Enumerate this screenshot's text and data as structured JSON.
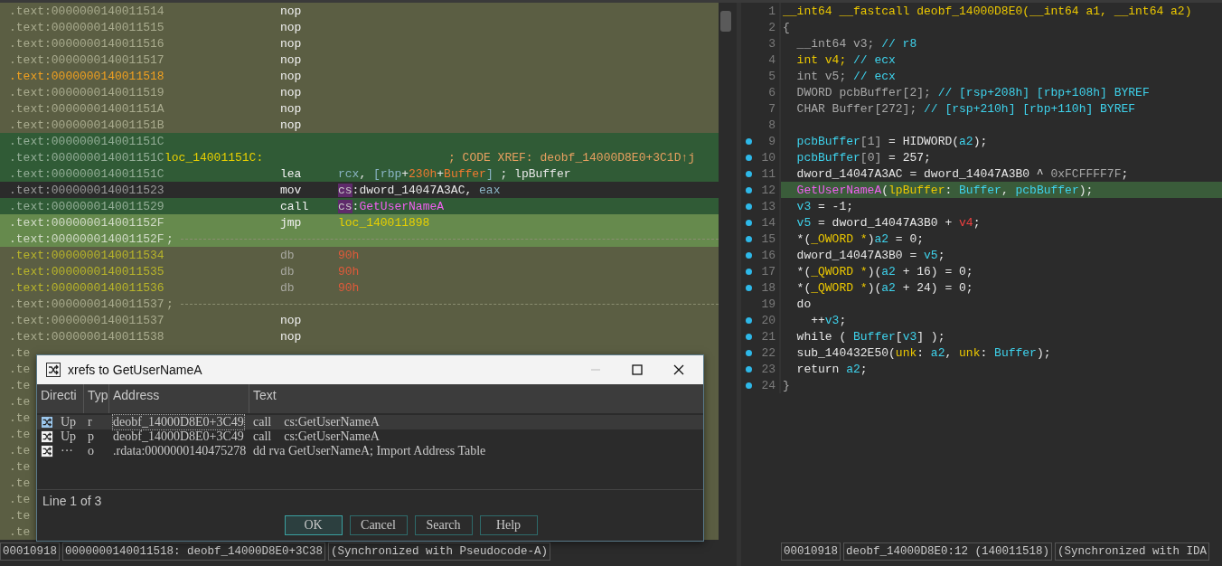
{
  "listing": {
    "rows": [
      {
        "address": ".text:0000000140011514",
        "kind": "plain",
        "current": false,
        "data": false,
        "mnemonic": "nop"
      },
      {
        "address": ".text:0000000140011515",
        "kind": "plain",
        "current": false,
        "data": false,
        "mnemonic": "nop"
      },
      {
        "address": ".text:0000000140011516",
        "kind": "plain",
        "current": false,
        "data": false,
        "mnemonic": "nop"
      },
      {
        "address": ".text:0000000140011517",
        "kind": "plain",
        "current": false,
        "data": false,
        "mnemonic": "nop"
      },
      {
        "address": ".text:0000000140011518",
        "kind": "plain",
        "current": true,
        "data": false,
        "mnemonic": "nop"
      },
      {
        "address": ".text:0000000140011519",
        "kind": "plain",
        "current": false,
        "data": false,
        "mnemonic": "nop"
      },
      {
        "address": ".text:000000014001151A",
        "kind": "plain",
        "current": false,
        "data": false,
        "mnemonic": "nop"
      },
      {
        "address": ".text:000000014001151B",
        "kind": "plain",
        "current": false,
        "data": false,
        "mnemonic": "nop"
      },
      {
        "address": ".text:000000014001151C",
        "kind": "block",
        "current": false,
        "data": false
      },
      {
        "address": ".text:000000014001151C",
        "kind": "block",
        "current": false,
        "data": false,
        "label": "loc_14001151C:",
        "comment": "; CODE XREF: deobf_14000D8E0+3C1D↑j"
      },
      {
        "address": ".text:000000014001151C",
        "kind": "block",
        "current": false,
        "data": false,
        "mnemonic": "lea",
        "operands": [
          {
            "kind": "reg",
            "text": "rcx"
          },
          {
            "kind": "plain",
            "text": ", "
          },
          {
            "kind": "punct",
            "text": "["
          },
          {
            "kind": "reg",
            "text": "rbp"
          },
          {
            "kind": "plain",
            "text": "+"
          },
          {
            "kind": "num",
            "text": "230h"
          },
          {
            "kind": "plain",
            "text": "+"
          },
          {
            "kind": "num",
            "text": "Buffer"
          },
          {
            "kind": "punct",
            "text": "]"
          },
          {
            "kind": "plain",
            "text": " ; lpBuffer"
          }
        ]
      },
      {
        "address": ".text:0000000140011523",
        "kind": "cursor",
        "current": false,
        "data": false,
        "mnemonic": "mov",
        "operands": [
          {
            "kind": "seg",
            "text": "cs"
          },
          {
            "kind": "plain",
            "text": ":dword_14047A3AC, "
          },
          {
            "kind": "reg",
            "text": "eax"
          }
        ]
      },
      {
        "address": ".text:0000000140011529",
        "kind": "block",
        "current": false,
        "data": false,
        "mnemonic": "call",
        "operands": [
          {
            "kind": "seg",
            "text": "cs"
          },
          {
            "kind": "plain",
            "text": ":"
          },
          {
            "kind": "func",
            "text": "GetUserNameA"
          }
        ]
      },
      {
        "address": ".text:000000014001152F",
        "kind": "jump",
        "current": false,
        "data": false,
        "mnemonic": "jmp",
        "operands": [
          {
            "kind": "label",
            "text": "loc_140011898"
          }
        ]
      },
      {
        "address": ".text:000000014001152F",
        "kind": "jump",
        "current": false,
        "data": false,
        "separator_mark": ";"
      },
      {
        "address": ".text:0000000140011534",
        "kind": "plain",
        "current": false,
        "data": true,
        "mnemonic": "db",
        "operands": [
          {
            "kind": "byte",
            "text": "90h"
          }
        ]
      },
      {
        "address": ".text:0000000140011535",
        "kind": "plain",
        "current": false,
        "data": true,
        "mnemonic": "db",
        "operands": [
          {
            "kind": "byte",
            "text": "90h"
          }
        ]
      },
      {
        "address": ".text:0000000140011536",
        "kind": "plain",
        "current": false,
        "data": true,
        "mnemonic": "db",
        "operands": [
          {
            "kind": "byte",
            "text": "90h"
          }
        ]
      },
      {
        "address": ".text:0000000140011537",
        "kind": "plain",
        "current": false,
        "data": false,
        "separator_mark": ";"
      },
      {
        "address": ".text:0000000140011537",
        "kind": "plain",
        "current": false,
        "data": false,
        "mnemonic": "nop"
      },
      {
        "address": ".text:0000000140011538",
        "kind": "plain",
        "current": false,
        "data": false,
        "mnemonic": "nop"
      },
      {
        "address": ".te",
        "kind": "plain",
        "current": false,
        "data": false
      },
      {
        "address": ".te",
        "kind": "plain",
        "current": false,
        "data": false
      },
      {
        "address": ".te",
        "kind": "plain",
        "current": false,
        "data": false
      },
      {
        "address": ".te",
        "kind": "plain",
        "current": false,
        "data": false
      },
      {
        "address": ".te",
        "kind": "plain",
        "current": false,
        "data": false
      },
      {
        "address": ".te",
        "kind": "plain",
        "current": false,
        "data": false
      },
      {
        "address": ".te",
        "kind": "plain",
        "current": false,
        "data": false
      },
      {
        "address": ".te",
        "kind": "plain",
        "current": false,
        "data": false
      },
      {
        "address": ".te",
        "kind": "plain",
        "current": false,
        "data": false
      },
      {
        "address": ".te",
        "kind": "plain",
        "current": false,
        "data": false
      },
      {
        "address": ".te",
        "kind": "plain",
        "current": false,
        "data": false
      },
      {
        "address": ".te",
        "kind": "plain",
        "current": false,
        "data": false
      }
    ],
    "status_bar": [
      "00010918",
      "0000000140011518: deobf_14000D8E0+3C38",
      "(Synchronized with Pseudocode-A)"
    ]
  },
  "xrefs_dialog": {
    "title": "xrefs to GetUserNameA",
    "columns": [
      "Directi",
      "Typ",
      "Address",
      "Text"
    ],
    "rows": [
      {
        "direction": "Up",
        "type": "r",
        "address": "deobf_14000D8E0+3C49",
        "text": "call    cs:GetUserNameA",
        "selected": true
      },
      {
        "direction": "Up",
        "type": "p",
        "address": "deobf_14000D8E0+3C49",
        "text": "call    cs:GetUserNameA",
        "selected": false
      },
      {
        "direction": "···",
        "type": "o",
        "address": ".rdata:0000000140475278",
        "text": "dd rva GetUserNameA; Import Address Table",
        "selected": false
      }
    ],
    "status": "Line 1 of 3",
    "buttons": [
      {
        "label": "OK",
        "focused": true
      },
      {
        "label": "Cancel",
        "focused": false
      },
      {
        "label": "Search",
        "focused": false
      },
      {
        "label": "Help",
        "focused": false
      }
    ]
  },
  "pseudocode": {
    "lines": [
      {
        "number": "1",
        "breakpoint": false,
        "selected": false,
        "tokens": [
          {
            "kind": "type",
            "text": "__int64 __fastcall deobf_14000D8E0(__int64 a1, __int64 a2)"
          }
        ]
      },
      {
        "number": "2",
        "breakpoint": false,
        "selected": false,
        "tokens": [
          {
            "kind": "dim",
            "text": "{"
          }
        ]
      },
      {
        "number": "3",
        "breakpoint": false,
        "selected": false,
        "tokens": [
          {
            "kind": "dim",
            "text": "  __int64 v3; "
          },
          {
            "kind": "var",
            "text": "// r8"
          }
        ]
      },
      {
        "number": "4",
        "breakpoint": false,
        "selected": false,
        "tokens": [
          {
            "kind": "type",
            "text": "  int v4; "
          },
          {
            "kind": "var",
            "text": "// ecx"
          }
        ]
      },
      {
        "number": "5",
        "breakpoint": false,
        "selected": false,
        "tokens": [
          {
            "kind": "dim",
            "text": "  int v5; "
          },
          {
            "kind": "var",
            "text": "// ecx"
          }
        ]
      },
      {
        "number": "6",
        "breakpoint": false,
        "selected": false,
        "tokens": [
          {
            "kind": "dim",
            "text": "  DWORD pcbBuffer[2]; "
          },
          {
            "kind": "var",
            "text": "// [rsp+208h] [rbp+108h] BYREF"
          }
        ]
      },
      {
        "number": "7",
        "breakpoint": false,
        "selected": false,
        "tokens": [
          {
            "kind": "dim",
            "text": "  CHAR Buffer[272]; "
          },
          {
            "kind": "var",
            "text": "// [rsp+210h] [rbp+110h] BYREF"
          }
        ]
      },
      {
        "number": "8",
        "breakpoint": false,
        "selected": false
      },
      {
        "number": "9",
        "breakpoint": true,
        "selected": false,
        "tokens": [
          {
            "kind": "var",
            "text": "  pcbBuffer"
          },
          {
            "kind": "dim",
            "text": "[1]"
          },
          {
            "kind": "plain",
            "text": " = HIDWORD("
          },
          {
            "kind": "var",
            "text": "a2"
          },
          {
            "kind": "plain",
            "text": ");"
          }
        ]
      },
      {
        "number": "10",
        "breakpoint": true,
        "selected": false,
        "tokens": [
          {
            "kind": "var",
            "text": "  pcbBuffer"
          },
          {
            "kind": "dim",
            "text": "[0]"
          },
          {
            "kind": "plain",
            "text": " = 257;"
          }
        ]
      },
      {
        "number": "11",
        "breakpoint": true,
        "selected": false,
        "tokens": [
          {
            "kind": "plain",
            "text": "  dword_14047A3AC = dword_14047A3B0 ^ "
          },
          {
            "kind": "dim",
            "text": "0xFCFFFF7F"
          },
          {
            "kind": "plain",
            "text": ";"
          }
        ]
      },
      {
        "number": "12",
        "breakpoint": true,
        "selected": true,
        "tokens": [
          {
            "kind": "func",
            "text": "  GetUserNameA"
          },
          {
            "kind": "plain",
            "text": "("
          },
          {
            "kind": "type",
            "text": "lpBuffer"
          },
          {
            "kind": "plain",
            "text": ": "
          },
          {
            "kind": "var",
            "text": "Buffer"
          },
          {
            "kind": "plain",
            "text": ", "
          },
          {
            "kind": "var",
            "text": "pcbBuffer"
          },
          {
            "kind": "plain",
            "text": ");"
          }
        ]
      },
      {
        "number": "13",
        "breakpoint": true,
        "selected": false,
        "tokens": [
          {
            "kind": "var",
            "text": "  v3"
          },
          {
            "kind": "plain",
            "text": " = -1;"
          }
        ]
      },
      {
        "number": "14",
        "breakpoint": true,
        "selected": false,
        "tokens": [
          {
            "kind": "var",
            "text": "  v5"
          },
          {
            "kind": "plain",
            "text": " = dword_14047A3B0 + "
          },
          {
            "kind": "bad",
            "text": "v4"
          },
          {
            "kind": "plain",
            "text": ";"
          }
        ]
      },
      {
        "number": "15",
        "breakpoint": true,
        "selected": false,
        "tokens": [
          {
            "kind": "plain",
            "text": "  *("
          },
          {
            "kind": "type",
            "text": "_OWORD *"
          },
          {
            "kind": "plain",
            "text": ")"
          },
          {
            "kind": "var",
            "text": "a2"
          },
          {
            "kind": "plain",
            "text": " = 0;"
          }
        ]
      },
      {
        "number": "16",
        "breakpoint": true,
        "selected": false,
        "tokens": [
          {
            "kind": "plain",
            "text": "  dword_14047A3B0 = "
          },
          {
            "kind": "var",
            "text": "v5"
          },
          {
            "kind": "plain",
            "text": ";"
          }
        ]
      },
      {
        "number": "17",
        "breakpoint": true,
        "selected": false,
        "tokens": [
          {
            "kind": "plain",
            "text": "  *("
          },
          {
            "kind": "type",
            "text": "_QWORD *"
          },
          {
            "kind": "plain",
            "text": ")("
          },
          {
            "kind": "var",
            "text": "a2"
          },
          {
            "kind": "plain",
            "text": " + 16) = 0;"
          }
        ]
      },
      {
        "number": "18",
        "breakpoint": true,
        "selected": false,
        "tokens": [
          {
            "kind": "plain",
            "text": "  *("
          },
          {
            "kind": "type",
            "text": "_QWORD *"
          },
          {
            "kind": "plain",
            "text": ")("
          },
          {
            "kind": "var",
            "text": "a2"
          },
          {
            "kind": "plain",
            "text": " + 24) = 0;"
          }
        ]
      },
      {
        "number": "19",
        "breakpoint": false,
        "selected": false,
        "tokens": [
          {
            "kind": "plain",
            "text": "  do"
          }
        ]
      },
      {
        "number": "20",
        "breakpoint": true,
        "selected": false,
        "tokens": [
          {
            "kind": "plain",
            "text": "    ++"
          },
          {
            "kind": "var",
            "text": "v3"
          },
          {
            "kind": "plain",
            "text": ";"
          }
        ]
      },
      {
        "number": "21",
        "breakpoint": true,
        "selected": false,
        "tokens": [
          {
            "kind": "plain",
            "text": "  while ( "
          },
          {
            "kind": "var",
            "text": "Buffer"
          },
          {
            "kind": "plain",
            "text": "["
          },
          {
            "kind": "var",
            "text": "v3"
          },
          {
            "kind": "plain",
            "text": "] );"
          }
        ]
      },
      {
        "number": "22",
        "breakpoint": true,
        "selected": false,
        "tokens": [
          {
            "kind": "plain",
            "text": "  sub_140432E50("
          },
          {
            "kind": "type",
            "text": "unk"
          },
          {
            "kind": "plain",
            "text": ": "
          },
          {
            "kind": "var",
            "text": "a2"
          },
          {
            "kind": "plain",
            "text": ", "
          },
          {
            "kind": "type",
            "text": "unk"
          },
          {
            "kind": "plain",
            "text": ": "
          },
          {
            "kind": "var",
            "text": "Buffer"
          },
          {
            "kind": "plain",
            "text": ");"
          }
        ]
      },
      {
        "number": "23",
        "breakpoint": true,
        "selected": false,
        "tokens": [
          {
            "kind": "plain",
            "text": "  return "
          },
          {
            "kind": "var",
            "text": "a2"
          },
          {
            "kind": "plain",
            "text": ";"
          }
        ]
      },
      {
        "number": "24",
        "breakpoint": true,
        "selected": false,
        "tokens": [
          {
            "kind": "dim",
            "text": "}"
          }
        ]
      }
    ],
    "status_bar": [
      "00010918",
      "deobf_14000D8E0:12 (140011518)",
      "(Synchronized with IDA"
    ]
  }
}
